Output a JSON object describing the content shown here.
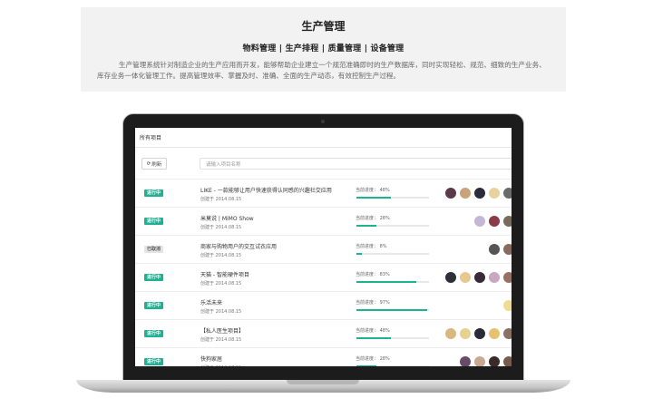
{
  "hero": {
    "title": "生产管理",
    "subtitle": "物料管理 | 生产排程 | 质量管理 | 设备管理",
    "description": "生产管理系统针对制造企业的生产应用而开发，能够帮助企业建立一个规范准确即时的生产数据库，同时实现轻松、规范、细致的生产业务、库存业务一体化管理工作。提高管理效率、掌握及时、准确、全面的生产动态，有效控制生产过程。"
  },
  "panel": {
    "title": "所有项目",
    "refresh_label": "刷新",
    "search_placeholder": "请输入项目名称"
  },
  "progress_label": "当前进度：",
  "rows": [
    {
      "status": "进行中",
      "closed": false,
      "name": "LIKE - 一款能够让用户快速获得认同感的兴趣社交应用",
      "date": "创建于 2014.08.15",
      "progress_text": "48%",
      "progress": 48,
      "avatars": [
        "#5b3a4a",
        "#c9a47a",
        "#2b2b3a",
        "#e8d3a0",
        "#6a6a6a"
      ]
    },
    {
      "status": "进行中",
      "closed": false,
      "name": "米莫说 | MiMO Show",
      "date": "创建于 2014.08.15",
      "progress_text": "28%",
      "progress": 28,
      "avatars": [
        "#c4b6d6",
        "#8a3a48",
        "#7a6a5a"
      ]
    },
    {
      "status": "已取消",
      "closed": true,
      "name": "商家与购物用户的交互试衣应用",
      "date": "创建于 2014.08.15",
      "progress_text": "8%",
      "progress": 8,
      "avatars": [
        "#555555",
        "#8a6a5a"
      ]
    },
    {
      "status": "进行中",
      "closed": false,
      "name": "天猫 - 智能硬件项目",
      "date": "创建于 2014.08.15",
      "progress_text": "83%",
      "progress": 83,
      "avatars": [
        "#2f2f3a",
        "#e8c890",
        "#3a2a3a",
        "#c8a8c0",
        "#9a7060"
      ]
    },
    {
      "status": "进行中",
      "closed": false,
      "name": "乐活未来",
      "date": "创建于 2014.08.15",
      "progress_text": "97%",
      "progress": 97,
      "avatars": [
        "#f0dc90"
      ]
    },
    {
      "status": "进行中",
      "closed": false,
      "name": "【私人医生项目】",
      "date": "创建于 2014.08.15",
      "progress_text": "48%",
      "progress": 48,
      "avatars": [
        "#d8b880",
        "#e8d090",
        "#2a2a3a",
        "#e8c070",
        "#8a7060"
      ]
    },
    {
      "status": "进行中",
      "closed": false,
      "name": "快狗家居",
      "date": "创建于 2014.08.15",
      "progress_text": "28%",
      "progress": 28,
      "avatars": [
        "#6a4a6a",
        "#c8a890",
        "#3a2a2a",
        "#7a5a4a"
      ]
    }
  ]
}
